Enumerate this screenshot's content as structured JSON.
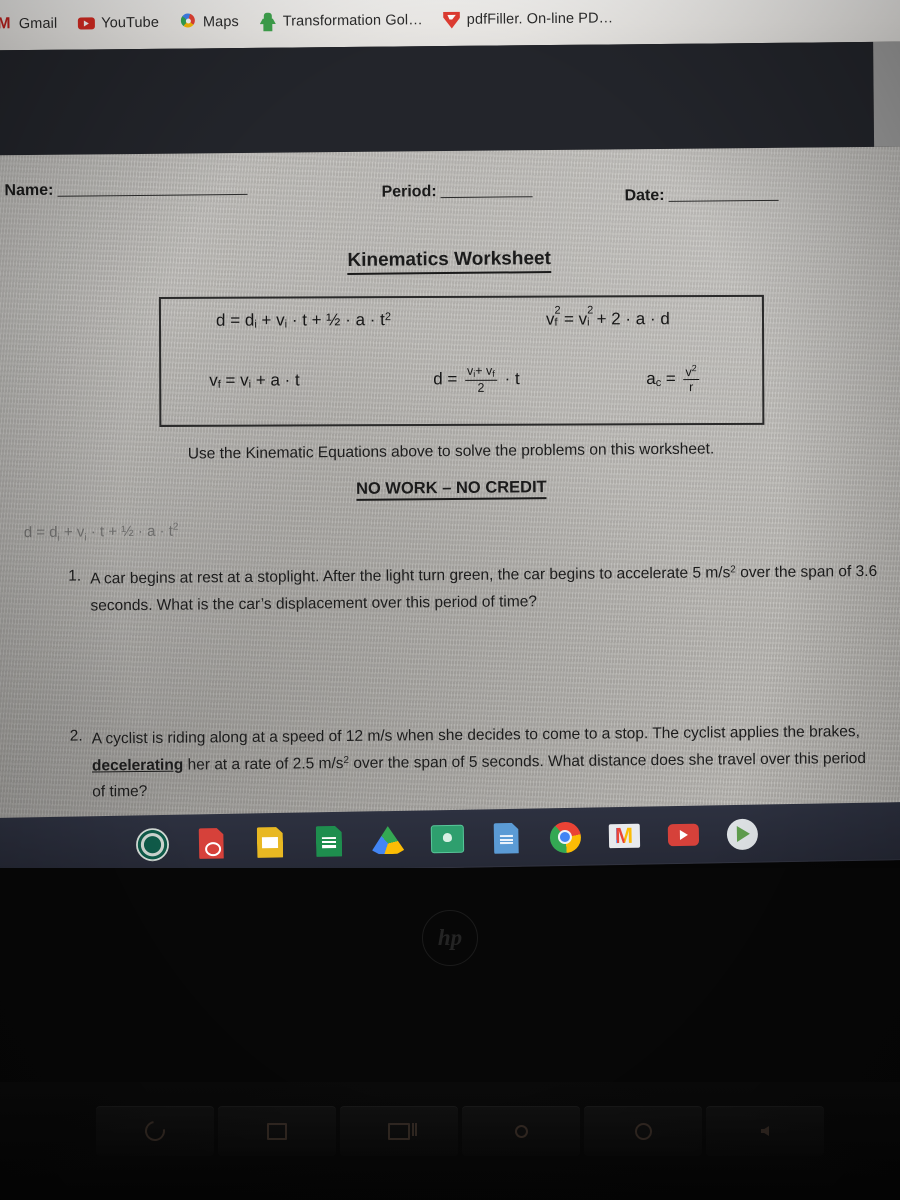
{
  "browser": {
    "bookmarks": [
      {
        "label": "Gmail",
        "icon": "gmail-icon"
      },
      {
        "label": "YouTube",
        "icon": "youtube-icon"
      },
      {
        "label": "Maps",
        "icon": "google-maps-icon"
      },
      {
        "label": "Transformation Gol…",
        "icon": "green-person-icon"
      },
      {
        "label": "pdfFiller. On-line PD…",
        "icon": "pdffiller-icon"
      }
    ]
  },
  "worksheet": {
    "fields": [
      {
        "label": "Name:"
      },
      {
        "label": "Period:"
      },
      {
        "label": "Date:"
      }
    ],
    "title": "Kinematics Worksheet",
    "equations": {
      "eq1": "d = dᵢ + vᵢ · t + ½ · a · t²",
      "eq2": "v²ₑ = v²ᵢ + 2 · a · d",
      "eq3": "vₑ = vᵢ + a · t",
      "eq4": "d = (vᵢ + vₑ) / 2 · t",
      "eq5": "aᴄ = v² / r",
      "parts": {
        "d": "d",
        "eq": "=",
        "di": "d",
        "sub_i": "i",
        "sub_f": "f",
        "sub_c": "c",
        "plus": "+",
        "dot": "·",
        "v": "v",
        "t": "t",
        "a": "a",
        "r": "r",
        "half": "½",
        "two": "2",
        "sq": "2"
      }
    },
    "instruction": "Use the Kinematic Equations above to solve the problems on this worksheet.",
    "emphasis": "NO WORK – NO CREDIT",
    "faint_equation": "d = dᵢ + vᵢ · t + ½ · a · t²",
    "problems": [
      {
        "number": "1.",
        "text_before": "A car begins at rest at a stoplight. After the light turn green, the car begins to accelerate 5 m/s",
        "sup": "2",
        "text_after": " over the span of 3.6 seconds. What is the car’s displacement over this period of time?"
      },
      {
        "number": "2.",
        "text_a": "A cyclist is riding along at a speed of 12 m/s when she decides to come to a stop. The cyclist applies the brakes, ",
        "emphasis": "decelerating",
        "text_b": " her at a rate of 2.5 m/s",
        "sup": "2",
        "text_c": " over the span of 5 seconds. What distance does she travel over this period of time?"
      }
    ]
  },
  "shelf": {
    "items": [
      {
        "name": "school-logo-icon"
      },
      {
        "name": "pdf-app-icon"
      },
      {
        "name": "google-slides-icon"
      },
      {
        "name": "google-sheets-icon"
      },
      {
        "name": "google-drive-icon"
      },
      {
        "name": "google-classroom-icon"
      },
      {
        "name": "google-docs-icon"
      },
      {
        "name": "chrome-icon"
      },
      {
        "name": "gmail-icon"
      },
      {
        "name": "youtube-icon"
      },
      {
        "name": "play-store-icon"
      }
    ]
  },
  "laptop": {
    "brand": "hp",
    "function_keys": [
      {
        "name": "refresh-key"
      },
      {
        "name": "fullscreen-key"
      },
      {
        "name": "window-overview-key"
      },
      {
        "name": "brightness-down-key"
      },
      {
        "name": "brightness-up-key"
      },
      {
        "name": "mute-key"
      }
    ]
  },
  "colors": {
    "paper": "#b7b5b1",
    "shelf": "#2d3140",
    "bookmark_bar": "#f3f2f0",
    "dark_band": "#23252b",
    "ink": "#1c1c1c"
  }
}
